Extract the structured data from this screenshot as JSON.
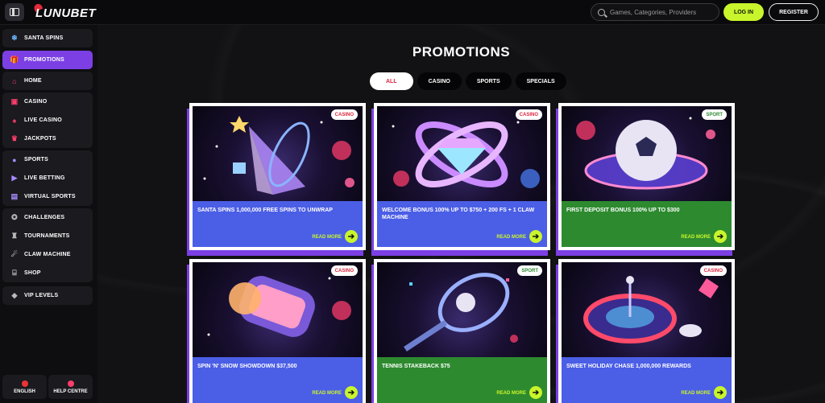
{
  "header": {
    "logo": "LUNUBET",
    "search_placeholder": "Games, Categories, Providers",
    "login_label": "LOG IN",
    "register_label": "REGISTER"
  },
  "sidebar": {
    "groups": [
      [
        {
          "label": "SANTA SPINS",
          "icon": "snowflake-icon"
        }
      ],
      [
        {
          "label": "PROMOTIONS",
          "icon": "gift-icon",
          "active": true
        }
      ],
      [
        {
          "label": "HOME",
          "icon": "home-icon"
        }
      ],
      [
        {
          "label": "CASINO",
          "icon": "slot-icon"
        },
        {
          "label": "LIVE CASINO",
          "icon": "cards-icon"
        },
        {
          "label": "JACKPOTS",
          "icon": "crown-icon"
        }
      ],
      [
        {
          "label": "SPORTS",
          "icon": "ball-icon"
        },
        {
          "label": "LIVE BETTING",
          "icon": "live-icon"
        },
        {
          "label": "VIRTUAL SPORTS",
          "icon": "virtual-icon"
        }
      ],
      [
        {
          "label": "CHALLENGES",
          "icon": "medal-icon"
        },
        {
          "label": "TOURNAMENTS",
          "icon": "trophy-icon"
        },
        {
          "label": "CLAW MACHINE",
          "icon": "claw-icon"
        },
        {
          "label": "SHOP",
          "icon": "basket-icon"
        }
      ],
      [
        {
          "label": "VIP LEVELS",
          "icon": "diamond-icon"
        }
      ]
    ],
    "footer": {
      "language": "ENGLISH",
      "help": "HELP CENTRE"
    }
  },
  "main": {
    "title": "PROMOTIONS",
    "filters": [
      "ALL",
      "CASINO",
      "SPORTS",
      "SPECIALS"
    ],
    "active_filter": "ALL",
    "read_more": "READ MORE",
    "promos": [
      {
        "title": "SANTA SPINS 1,000,000 FREE SPINS TO UNWRAP",
        "badge": "CASINO",
        "color": "blue"
      },
      {
        "title": "WELCOME BONUS 100% UP TO $750 + 200 FS + 1 CLAW MACHINE",
        "badge": "CASINO",
        "color": "blue"
      },
      {
        "title": "FIRST DEPOSIT BONUS 100% UP TO $300",
        "badge": "SPORT",
        "color": "green"
      },
      {
        "title": "SPIN 'N' SNOW SHOWDOWN $37,500",
        "badge": "CASINO",
        "color": "blue"
      },
      {
        "title": "TENNIS STAKEBACK $75",
        "badge": "SPORT",
        "color": "green"
      },
      {
        "title": "SWEET HOLIDAY CHASE 1,000,000 REWARDS",
        "badge": "CASINO",
        "color": "blue"
      }
    ]
  },
  "colors": {
    "accent": "#c8f52b",
    "active_nav": "#7b3fe4",
    "promo_blue": "#4b5ee6",
    "promo_green": "#2d8a2f",
    "badge_red": "#e0243e"
  }
}
